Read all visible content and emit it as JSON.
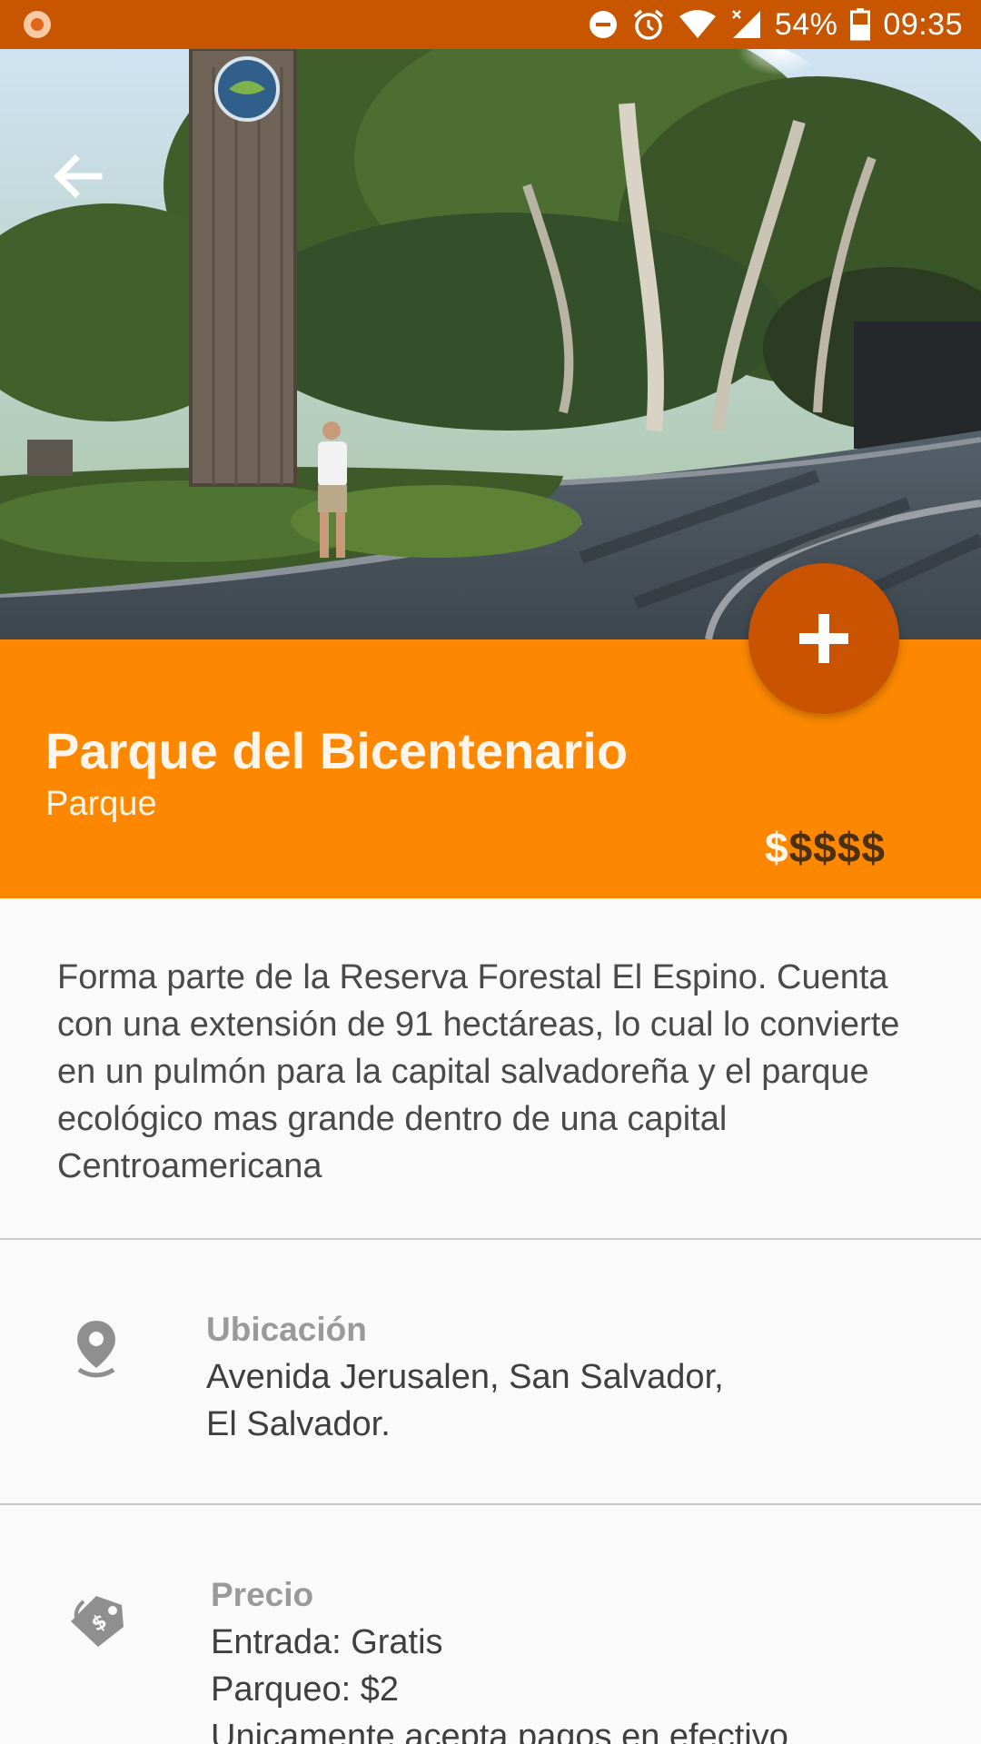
{
  "status_bar": {
    "battery_percent": "54%",
    "time": "09:35"
  },
  "hero": {
    "image_description_icon": "park-photo",
    "back_icon": "arrow-left-icon"
  },
  "place": {
    "title": "Parque del Bicentenario",
    "category": "Parque",
    "price_level": {
      "active": "$",
      "inactive": "$$$$"
    }
  },
  "fab": {
    "icon": "plus-icon"
  },
  "description": "Forma parte de la Reserva Forestal El Espino. Cuenta con una extensión de 91 hectáreas, lo cual lo convierte en un pulmón para la capital salvadoreña y el parque ecológico mas grande dentro de una capital Centroamericana",
  "location": {
    "icon": "map-pin-icon",
    "label": "Ubicación",
    "lines": [
      "Avenida Jerusalen, San Salvador,",
      "El Salvador."
    ]
  },
  "price": {
    "icon": "price-tag-icon",
    "label": "Precio",
    "lines": [
      "Entrada: Gratis",
      "Parqueo: $2",
      "Unicamente acepta pagos en efectivo"
    ]
  },
  "colors": {
    "status_bar": "#c85500",
    "accent": "#fd8800",
    "fab": "#c95300"
  }
}
